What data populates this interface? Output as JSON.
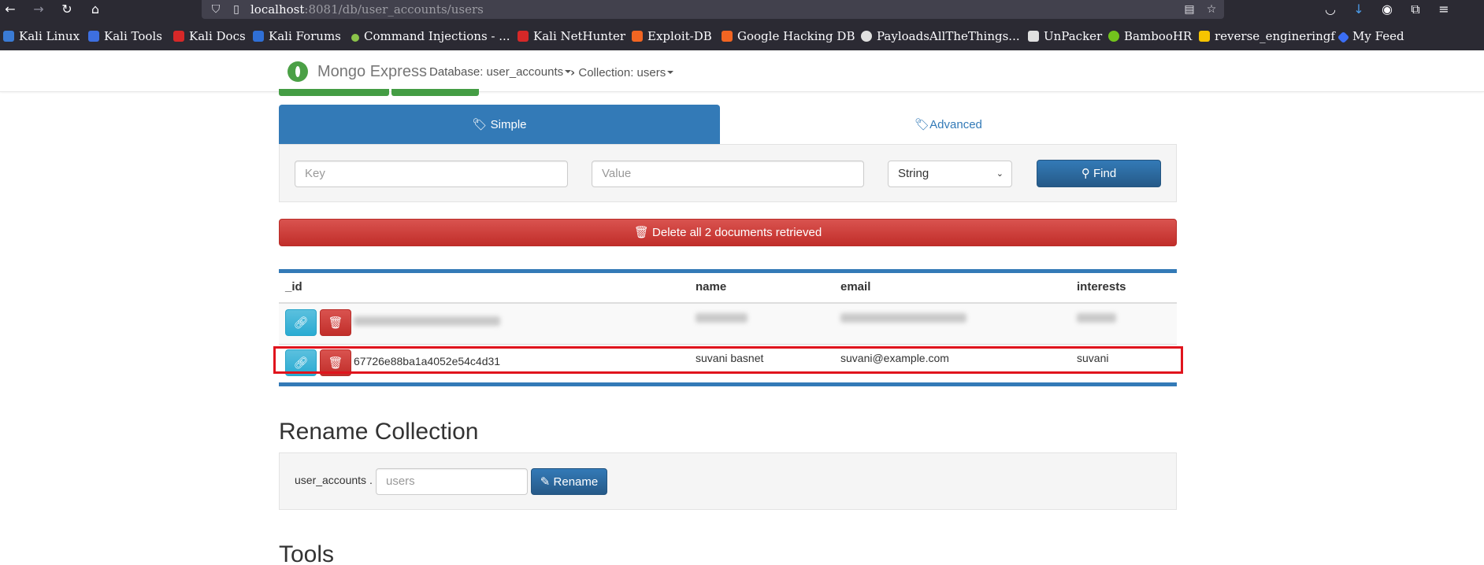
{
  "browser": {
    "url_host": "localhost",
    "url_rest": ":8081/db/user_accounts/users",
    "bookmarks": [
      {
        "label": "Kali Linux",
        "color": "#3a7bd5"
      },
      {
        "label": "Kali Tools",
        "color": "#3d6fe0"
      },
      {
        "label": "Kali Docs",
        "color": "#d62828"
      },
      {
        "label": "Kali Forums",
        "color": "#2f6fd6"
      },
      {
        "label": "Command Injections - ...",
        "color": "#8bc34a"
      },
      {
        "label": "Kali NetHunter",
        "color": "#d62828"
      },
      {
        "label": "Exploit-DB",
        "color": "#f26522"
      },
      {
        "label": "Google Hacking DB",
        "color": "#f26522"
      },
      {
        "label": "PayloadsAllTheThings...",
        "color": "#e0e0e0"
      },
      {
        "label": "UnPacker",
        "color": "#e0e0e0"
      },
      {
        "label": "BambooHR",
        "color": "#73c41d"
      },
      {
        "label": "reverse_engineringf",
        "color": "#f6c400"
      },
      {
        "label": "My Feed",
        "color": "#3b6ef5"
      }
    ]
  },
  "navbar": {
    "brand": "Mongo Express",
    "database": "Database: user_accounts",
    "collection": "Collection: users"
  },
  "search": {
    "tab_simple": "Simple",
    "tab_advanced": "Advanced",
    "key_placeholder": "Key",
    "value_placeholder": "Value",
    "type_selected": "String",
    "find_label": "Find"
  },
  "delete_all_label": "Delete all 2 documents retrieved",
  "table": {
    "headers": [
      "_id",
      "name",
      "email",
      "interests"
    ],
    "rows": [
      {
        "id": "",
        "name": "",
        "email": "",
        "interests": "",
        "redacted": true
      },
      {
        "id": "67726e88ba1a4052e54c4d31",
        "name": "suvani basnet",
        "email": "suvani@example.com",
        "interests": "suvani",
        "redacted": false
      }
    ]
  },
  "rename": {
    "heading": "Rename Collection",
    "db_label": "user_accounts .",
    "placeholder": "users",
    "button": "Rename"
  },
  "tools_heading": "Tools",
  "colors": {
    "primary": "#337ab7",
    "danger": "#d9534f",
    "info": "#5bc0de",
    "highlight": "#e0141d"
  }
}
